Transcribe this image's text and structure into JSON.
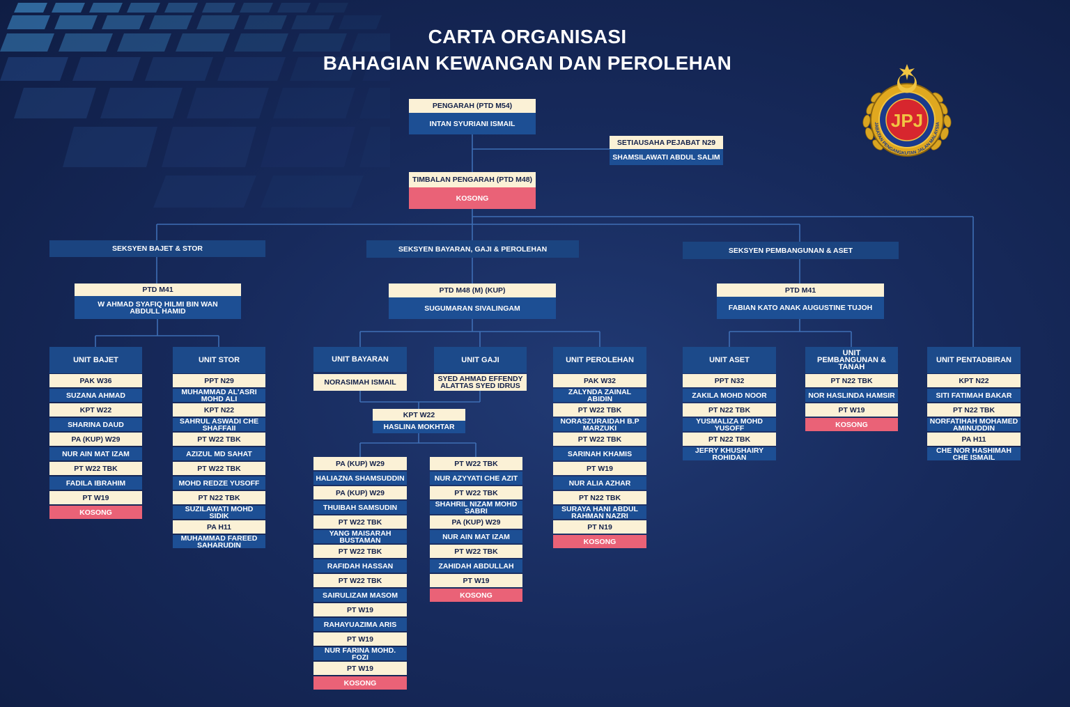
{
  "title_line1": "CARTA ORGANISASI",
  "title_line2": "BAHAGIAN KEWANGAN DAN PEROLEHAN",
  "logo": {
    "monogram": "JPJ",
    "ring_text": "JABATAN PENGANGKUTAN JALAN MALAYSIA"
  },
  "colors": {
    "position": "#fbf1d6",
    "name": "#1d4f94",
    "vacant": "#ea6277",
    "section": "#1b4480",
    "line": "#3f6fb5"
  },
  "top": {
    "director": {
      "position": "PENGARAH (PTD M54)",
      "name": "INTAN SYURIANI ISMAIL"
    },
    "secretary": {
      "position": "SETIAUSAHA PEJABAT N29",
      "name": "SHAMSILAWATI ABDUL SALIM"
    },
    "deputy": {
      "position": "TIMBALAN PENGARAH (PTD M48)",
      "name": "KOSONG"
    }
  },
  "sections": {
    "bajet": {
      "label": "SEKSYEN BAJET & STOR",
      "head_position": "PTD M41",
      "head_name": "W AHMAD SYAFIQ HILMI BIN WAN ABDULL HAMID",
      "units": {
        "bajet": {
          "label": "UNIT BAJET",
          "rows": [
            "PAK W36",
            "SUZANA AHMAD",
            "KPT W22",
            "SHARINA DAUD",
            "PA (KUP) W29",
            "NUR AIN MAT IZAM",
            "PT W22 TBK",
            "FADILA IBRAHIM",
            "PT W19",
            "KOSONG"
          ]
        },
        "stor": {
          "label": "UNIT STOR",
          "rows": [
            "PPT N29",
            "MUHAMMAD AL'ASRI MOHD ALI",
            "KPT N22",
            "SAHRUL ASWADI CHE SHAFFAII",
            "PT W22 TBK",
            "AZIZUL MD SAHAT",
            "PT W22 TBK",
            "MOHD REDZE YUSOFF",
            "PT N22 TBK",
            "SUZILAWATI MOHD SIDIK",
            "PA  H11",
            "MUHAMMAD FAREED SAHARUDIN"
          ]
        }
      }
    },
    "bayaran": {
      "label": "SEKSYEN BAYARAN, GAJI & PEROLEHAN",
      "head_position": "PTD M48 (M) (KUP)",
      "head_name": "SUGUMARAN SIVALINGAM",
      "units": {
        "bayaran": {
          "label": "UNIT BAYARAN",
          "name": "NORASIMAH ISMAIL"
        },
        "gaji": {
          "label": "UNIT GAJI",
          "name": "SYED AHMAD EFFENDY ALATTAS SYED IDRUS"
        },
        "kpt": {
          "position": "KPT W22",
          "name": "HASLINA MOKHTAR"
        },
        "col1": [
          "PA (KUP) W29",
          "HALIAZNA SHAMSUDDIN",
          "PA (KUP) W29",
          "THUIBAH SAMSUDIN",
          "PT W22 TBK",
          "YANG MAISARAH BUSTAMAN",
          "PT W22 TBK",
          "RAFIDAH HASSAN",
          "PT W22 TBK",
          "SAIRULIZAM MASOM",
          "PT W19",
          "RAHAYUAZIMA ARIS",
          "PT W19",
          "NUR FARINA MOHD. FOZI",
          "PT W19",
          "KOSONG"
        ],
        "col2": [
          "PT W22 TBK",
          "NUR AZYYATI CHE AZIT",
          "PT W22 TBK",
          "SHAHRIL NIZAM  MOHD SABRI",
          "PA (KUP) W29",
          "NUR AIN MAT IZAM",
          "PT W22 TBK",
          "ZAHIDAH ABDULLAH",
          "PT W19",
          "KOSONG"
        ],
        "perolehan": {
          "label": "UNIT PEROLEHAN",
          "rows": [
            "PAK W32",
            "ZALYNDA ZAINAL ABIDIN",
            "PT W22 TBK",
            "NORASZURAIDAH B.P MARZUKI",
            "PT W22 TBK",
            "SARINAH KHAMIS",
            "PT W19",
            "NUR ALIA AZHAR",
            "PT N22 TBK",
            "SURAYA HANI ABDUL RAHMAN NAZRI",
            "PT N19",
            "KOSONG"
          ]
        }
      }
    },
    "pembangunan": {
      "label": "SEKSYEN PEMBANGUNAN & ASET",
      "head_position": "PTD M41",
      "head_name": "FABIAN KATO ANAK AUGUSTINE TUJOH",
      "units": {
        "aset": {
          "label": "UNIT ASET",
          "rows": [
            "PPT N32",
            "ZAKILA MOHD NOOR",
            "PT N22 TBK",
            "YUSMALIZA MOHD YUSOFF",
            "PT N22 TBK",
            "JEFRY KHUSHAIRY ROHIDAN"
          ]
        },
        "pembangunan": {
          "label": "UNIT PEMBANGUNAN & TANAH",
          "rows": [
            "PT N22 TBK",
            "NOR HASLINDA HAMSIR",
            "PT W19",
            "KOSONG"
          ]
        }
      }
    },
    "pentadbiran": {
      "label": "UNIT PENTADBIRAN",
      "rows": [
        "KPT N22",
        "SITI FATIMAH BAKAR",
        "PT N22 TBK",
        "NORFATIHAH MOHAMED AMINUDDIN",
        "PA H11",
        "CHE NOR HASHIMAH CHE ISMAIL"
      ]
    }
  }
}
